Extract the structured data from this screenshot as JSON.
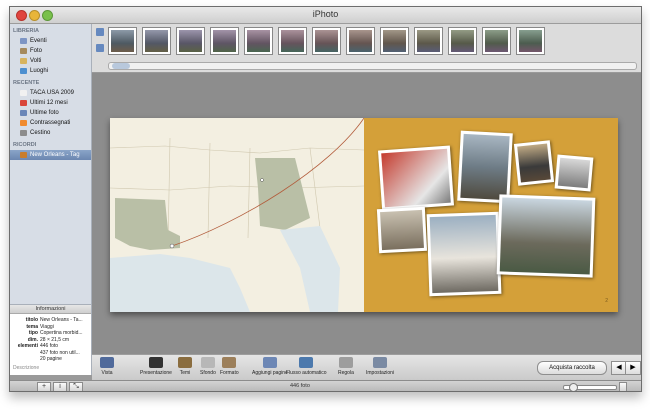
{
  "window": {
    "title": "iPhoto"
  },
  "sidebar": {
    "library_header": "LIBRERIA",
    "library": [
      {
        "label": "Eventi",
        "icon": "events-icon",
        "color": "#7d95c4"
      },
      {
        "label": "Foto",
        "icon": "photos-icon",
        "color": "#a58a5d"
      },
      {
        "label": "Volti",
        "icon": "faces-icon",
        "color": "#d7b45f"
      },
      {
        "label": "Luoghi",
        "icon": "places-icon",
        "color": "#4c8fd0"
      }
    ],
    "recent_header": "RECENTE",
    "recent": [
      {
        "label": "TACA USA 2009",
        "icon": "event-icon",
        "color": "#f1f1f1"
      },
      {
        "label": "Ultimi 12 mesi",
        "icon": "calendar-icon",
        "color": "#d9463a"
      },
      {
        "label": "Ultime foto",
        "icon": "import-icon",
        "color": "#6a86b8"
      },
      {
        "label": "Contrassegnati",
        "icon": "flag-icon",
        "color": "#f08a2e"
      },
      {
        "label": "Cestino",
        "icon": "trash-icon",
        "color": "#8c8c8c"
      }
    ],
    "memories_header": "RICORDI",
    "memories": [
      {
        "label": "New Orleans - Tag",
        "icon": "book-icon",
        "color": "#c97d2c",
        "selected": true
      }
    ]
  },
  "info": {
    "title": "Informazioni",
    "rows": [
      {
        "k": "titolo",
        "v": "New Orleans - Ta..."
      },
      {
        "k": "tema",
        "v": "Viaggi"
      },
      {
        "k": "tipo",
        "v": "Copertina morbid..."
      },
      {
        "k": "dim.",
        "v": "28 × 21,5 cm"
      },
      {
        "k": "elementi",
        "v": "446 foto"
      },
      {
        "k": "",
        "v": "437 foto non util..."
      },
      {
        "k": "",
        "v": "20 pagine"
      }
    ],
    "description_placeholder": "Descrizione"
  },
  "toolbar": {
    "buttons": [
      {
        "label": "Vista",
        "icon": "view-icon",
        "color": "#506a9b"
      },
      {
        "label": "Presentazione",
        "icon": "slideshow-icon",
        "color": "#333333"
      },
      {
        "label": "Temi",
        "icon": "themes-icon",
        "color": "#8a6d3f"
      },
      {
        "label": "Sfondo",
        "icon": "background-icon",
        "color": "#b7b7b7"
      },
      {
        "label": "Formato",
        "icon": "layout-icon",
        "color": "#9c7f5a"
      },
      {
        "label": "Aggiungi pagine",
        "icon": "add-pages-icon",
        "color": "#6d87b5"
      },
      {
        "label": "Flusso automatico",
        "icon": "autoflow-icon",
        "color": "#4c79ad"
      },
      {
        "label": "Regola",
        "icon": "adjust-icon",
        "color": "#9d9d9d"
      },
      {
        "label": "Impostazioni",
        "icon": "settings-icon",
        "color": "#7a8aa3"
      }
    ],
    "buy_label": "Acquista raccolta",
    "prev_glyph": "◀",
    "next_glyph": "▶"
  },
  "status": {
    "count": "446 foto",
    "add_glyph": "+",
    "info_glyph": "i",
    "zoom": 0.1
  },
  "thumbnails_count": 13,
  "colors": {
    "sidebar_bg": "#d7dde6",
    "selection": "#7592bb",
    "book_right_bg": "#d4a039"
  }
}
